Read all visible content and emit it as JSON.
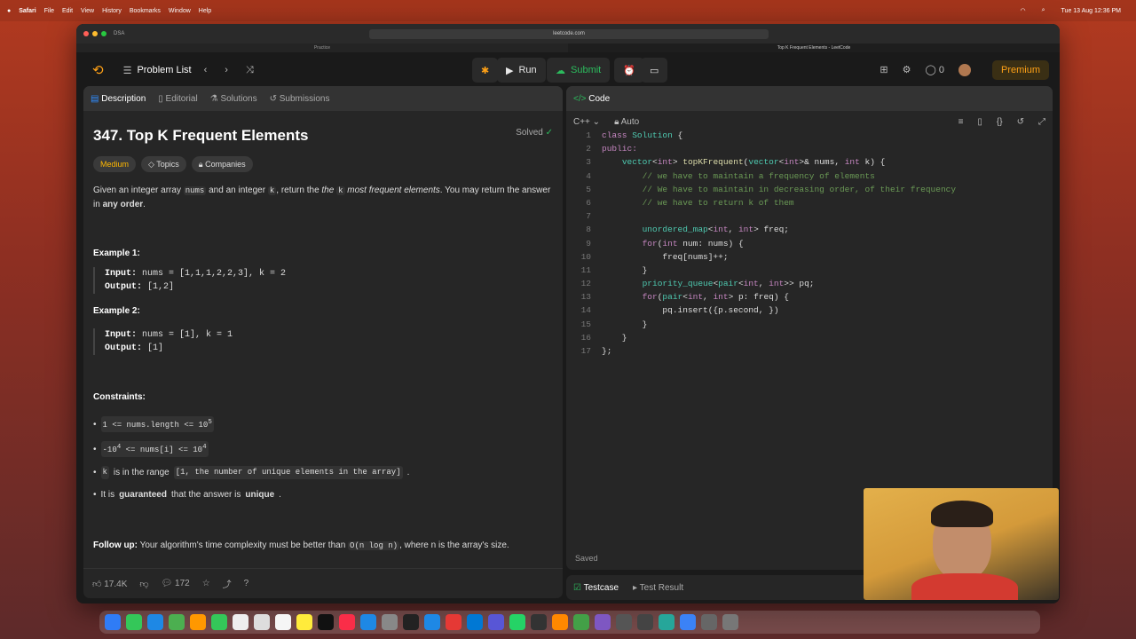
{
  "menubar": {
    "apple": "",
    "app": "Safari",
    "items": [
      "File",
      "Edit",
      "View",
      "History",
      "Bookmarks",
      "Window",
      "Help"
    ],
    "clock": "Tue 13 Aug 12:36 PM"
  },
  "browser": {
    "url": "leetcode.com",
    "tab1": "Practice",
    "tab2": "Top K Frequent Elements - LeetCode",
    "sidebar": "DSA"
  },
  "topbar": {
    "problem_list": "Problem List",
    "run": "Run",
    "submit": "Submit",
    "streak": "0",
    "premium": "Premium"
  },
  "left": {
    "tabs": [
      "Description",
      "Editorial",
      "Solutions",
      "Submissions"
    ],
    "title": "347. Top K Frequent Elements",
    "solved": "Solved",
    "tags": [
      "Medium",
      "Topics",
      "Companies"
    ],
    "desc1": "Given an integer array",
    "nums": "nums",
    "desc2": "and an integer",
    "k": "k",
    "desc3": ", return the",
    "desc4": "the",
    "desc5": "most frequent elements",
    "desc6": ". You may return the answer in",
    "desc7": "any order",
    "ex1_title": "Example 1:",
    "ex1_in": "nums = [1,1,1,2,2,3], k = 2",
    "ex1_out": "[1,2]",
    "ex2_title": "Example 2:",
    "ex2_in": "nums = [1], k = 1",
    "ex2_out": "[1]",
    "input_label": "Input:",
    "output_label": "Output:",
    "constraints": "Constraints:",
    "c1": "1 <= nums.length <= 10",
    "c1sup": "5",
    "c2a": "-10",
    "c2sup1": "4",
    "c2b": " <= nums[i] <= 10",
    "c2sup2": "4",
    "c3a": "is in the range",
    "c3b": "[1, the number of unique elements in the array]",
    "c4a": "It is",
    "c4b": "guaranteed",
    "c4c": "that the answer is",
    "c4d": "unique",
    "follow_label": "Follow up:",
    "follow": "Your algorithm's time complexity must be better than",
    "follow_code": "O(n log n)",
    "follow_end": ", where n is the array's size.",
    "likes": "17.4K",
    "comments": "172"
  },
  "right": {
    "title": "Code",
    "lang": "C++",
    "auto": "Auto",
    "saved": "Saved",
    "testcase": "Testcase",
    "testresult": "Test Result"
  },
  "colors": {
    "accent": "#ffa116",
    "green": "#2cbb5d",
    "bg": "#262626"
  }
}
